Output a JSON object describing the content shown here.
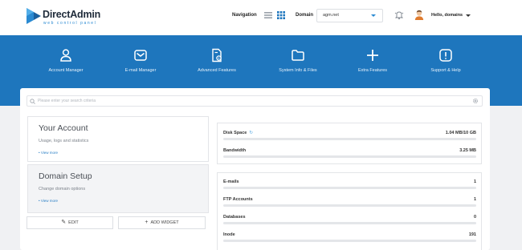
{
  "header": {
    "brand": "DirectAdmin",
    "tagline": "web control panel",
    "navigation_label": "Navigation",
    "domain_label": "Domain",
    "domain_value": "agm.net",
    "user_greeting": "Hello, domains",
    "icons": [
      "list-view-icon",
      "grid-view-icon",
      "notifications-icon",
      "user-avatar-icon"
    ]
  },
  "menu": [
    {
      "label": "Account Manager",
      "icon": "user-icon"
    },
    {
      "label": "E-mail Manager",
      "icon": "mail-icon"
    },
    {
      "label": "Advanced Features",
      "icon": "document-gear-icon"
    },
    {
      "label": "System Info & Files",
      "icon": "folder-icon"
    },
    {
      "label": "Extra Features",
      "icon": "plus-icon"
    },
    {
      "label": "Support & Help",
      "icon": "alert-icon"
    }
  ],
  "search": {
    "placeholder": "Please enter your search criteria"
  },
  "panels": {
    "account": {
      "title": "Your Account",
      "desc": "Usage, logs and statistics",
      "more": "• View more"
    },
    "domain": {
      "title": "Domain Setup",
      "desc": "Change domain options",
      "more": "• View more"
    }
  },
  "buttons": {
    "edit": "EDIT",
    "add_widget": "ADD WIDGET"
  },
  "usage": [
    {
      "label": "Disk Space",
      "value": "1.04 MB/10 GB",
      "fraction": 0.0001
    },
    {
      "label": "Bandwidth",
      "value": "3.25 MB",
      "fraction": 0
    }
  ],
  "counts": [
    {
      "label": "E-mails",
      "value": "1",
      "fraction": 0
    },
    {
      "label": "FTP Accounts",
      "value": "1",
      "fraction": 0
    },
    {
      "label": "Databases",
      "value": "0",
      "fraction": 0
    },
    {
      "label": "Inode",
      "value": "191",
      "fraction": 0
    }
  ],
  "colors": {
    "accent": "#1e76bd",
    "link": "#2a7fc5",
    "background": "#f0f1f3"
  }
}
